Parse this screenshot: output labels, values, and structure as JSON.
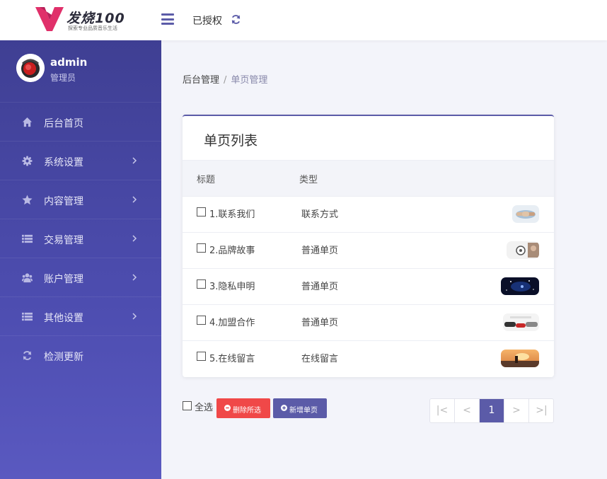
{
  "brand": {
    "name": "发烧100",
    "slogan": "探索专业品质音乐生活"
  },
  "header": {
    "auth_status": "已授权"
  },
  "user": {
    "name": "admin",
    "role": "管理员"
  },
  "sidebar": {
    "items": [
      {
        "label": "后台首页",
        "icon": "home-icon",
        "has_submenu": false
      },
      {
        "label": "系统设置",
        "icon": "gear-icon",
        "has_submenu": true
      },
      {
        "label": "内容管理",
        "icon": "star-icon",
        "has_submenu": true
      },
      {
        "label": "交易管理",
        "icon": "list-icon",
        "has_submenu": true
      },
      {
        "label": "账户管理",
        "icon": "users-icon",
        "has_submenu": true
      },
      {
        "label": "其他设置",
        "icon": "list-icon",
        "has_submenu": true
      },
      {
        "label": "检测更新",
        "icon": "refresh-icon",
        "has_submenu": false
      }
    ]
  },
  "breadcrumb": {
    "home": "后台管理",
    "separator": "/",
    "current": "单页管理"
  },
  "card": {
    "title": "单页列表",
    "columns": {
      "title": "标题",
      "type": "类型"
    },
    "rows": [
      {
        "title": "1.联系我们",
        "type": "联系方式",
        "thumb": "handshake-image"
      },
      {
        "title": "2.品牌故事",
        "type": "普通单页",
        "thumb": "brand-image"
      },
      {
        "title": "3.隐私申明",
        "type": "普通单页",
        "thumb": "space-image"
      },
      {
        "title": "4.加盟合作",
        "type": "普通单页",
        "thumb": "cars-image"
      },
      {
        "title": "5.在线留言",
        "type": "在线留言",
        "thumb": "sunset-image"
      }
    ]
  },
  "actions": {
    "select_all": "全选",
    "delete_selected": "删除所选",
    "add_page": "新增单页"
  },
  "pagination": {
    "first": "|<",
    "prev": "<",
    "current": "1",
    "next": ">",
    "last": ">|"
  },
  "colors": {
    "primary": "#5b5ba8",
    "sidebar": "#4545a0",
    "danger": "#f04848",
    "background": "#f3f4fa"
  }
}
